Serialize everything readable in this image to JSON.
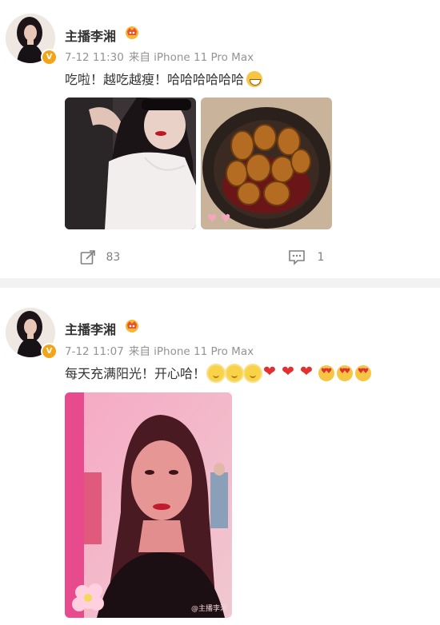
{
  "posts": [
    {
      "author": "主播李湘",
      "time": "7-12 11:30",
      "source": "来自 iPhone 11 Pro Max",
      "text": "吃啦！越吃越瘦！哈哈哈哈哈哈",
      "emojis": [
        "laugh-emoji"
      ],
      "images": [
        "selfie-in-car-photo",
        "braised-abalone-dish-photo"
      ],
      "repost_count": "83",
      "comment_count": "1"
    },
    {
      "author": "主播李湘",
      "time": "7-12 11:07",
      "source": "来自 iPhone 11 Pro Max",
      "text": "每天充满阳光！开心哈！",
      "emojis": [
        "sun-smile-emoji",
        "sun-smile-emoji",
        "sun-smile-emoji",
        "heart-emoji",
        "heart-emoji",
        "heart-emoji",
        "heart-eyes-emoji",
        "heart-eyes-emoji",
        "heart-eyes-emoji"
      ],
      "images": [
        "pink-selfie-portrait-photo"
      ],
      "watermark": "@主播李湘"
    }
  ],
  "colors": {
    "badge": "#f2a51a",
    "meta": "#939393",
    "divider": "#f2f2f2",
    "heart": "#e23030"
  }
}
